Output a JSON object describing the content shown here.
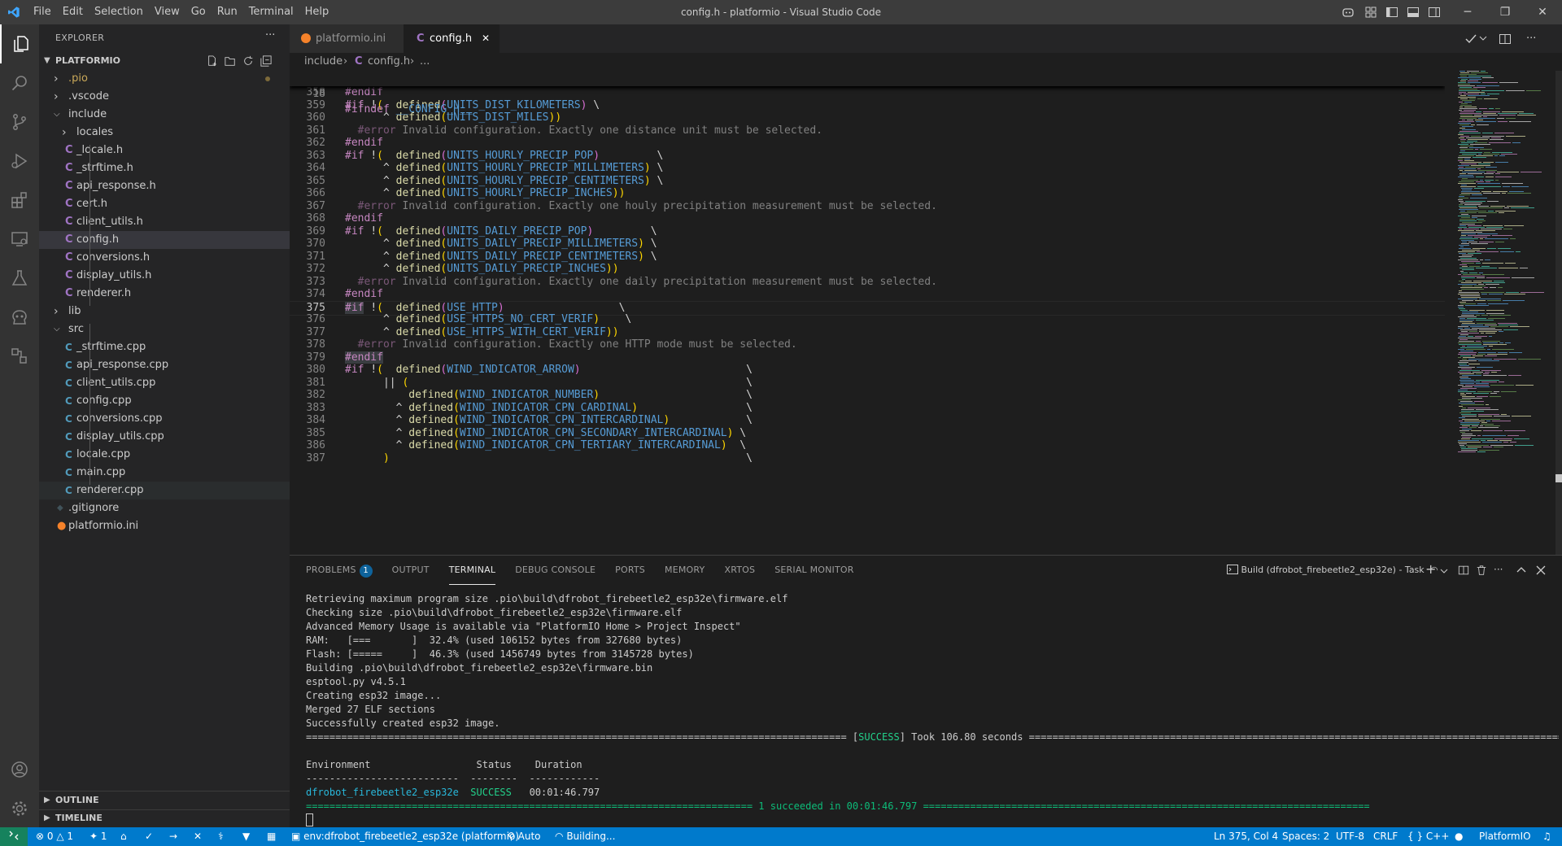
{
  "titlebar": {
    "menu": [
      "File",
      "Edit",
      "Selection",
      "View",
      "Go",
      "Run",
      "Terminal",
      "Help"
    ],
    "title": "config.h - platformio - Visual Studio Code",
    "window_controls": {
      "minimize": "─",
      "restore": "❐",
      "close": "✕"
    }
  },
  "activity_bar": {
    "items": [
      "files-icon",
      "search-icon",
      "source-control-icon",
      "run-debug-icon",
      "extensions-icon",
      "remote-explorer-icon",
      "testing-icon",
      "platformio-icon",
      "misc-icon"
    ],
    "bottom": [
      "account-icon",
      "settings-gear-icon"
    ]
  },
  "sidebar": {
    "title": "EXPLORER",
    "more": "···",
    "root": "PLATFORMIO",
    "tree": [
      {
        "label": ".pio",
        "kind": "folder",
        "depth": 0,
        "modified": true
      },
      {
        "label": ".vscode",
        "kind": "folder",
        "depth": 0
      },
      {
        "label": "include",
        "kind": "folder-open",
        "depth": 0
      },
      {
        "label": "locales",
        "kind": "folder",
        "depth": 1
      },
      {
        "label": "_locale.h",
        "kind": "h",
        "depth": 1
      },
      {
        "label": "_strftime.h",
        "kind": "h",
        "depth": 1
      },
      {
        "label": "api_response.h",
        "kind": "h",
        "depth": 1
      },
      {
        "label": "cert.h",
        "kind": "h",
        "depth": 1
      },
      {
        "label": "client_utils.h",
        "kind": "h",
        "depth": 1
      },
      {
        "label": "config.h",
        "kind": "h",
        "depth": 1,
        "selected": true
      },
      {
        "label": "conversions.h",
        "kind": "h",
        "depth": 1
      },
      {
        "label": "display_utils.h",
        "kind": "h",
        "depth": 1
      },
      {
        "label": "renderer.h",
        "kind": "h",
        "depth": 1
      },
      {
        "label": "lib",
        "kind": "folder",
        "depth": 0
      },
      {
        "label": "src",
        "kind": "folder-open",
        "depth": 0
      },
      {
        "label": "_strftime.cpp",
        "kind": "cpp",
        "depth": 1
      },
      {
        "label": "api_response.cpp",
        "kind": "cpp",
        "depth": 1
      },
      {
        "label": "client_utils.cpp",
        "kind": "cpp",
        "depth": 1
      },
      {
        "label": "config.cpp",
        "kind": "cpp",
        "depth": 1
      },
      {
        "label": "conversions.cpp",
        "kind": "cpp",
        "depth": 1
      },
      {
        "label": "display_utils.cpp",
        "kind": "cpp",
        "depth": 1
      },
      {
        "label": "locale.cpp",
        "kind": "cpp",
        "depth": 1
      },
      {
        "label": "main.cpp",
        "kind": "cpp",
        "depth": 1
      },
      {
        "label": "renderer.cpp",
        "kind": "cpp",
        "depth": 1,
        "hover": true
      },
      {
        "label": ".gitignore",
        "kind": "git",
        "depth": 0
      },
      {
        "label": "platformio.ini",
        "kind": "pio",
        "depth": 0
      }
    ],
    "outline": "OUTLINE",
    "timeline": "TIMELINE"
  },
  "tabs": [
    {
      "label": "platformio.ini",
      "active": false
    },
    {
      "label": "config.h",
      "active": true,
      "close": "✕"
    }
  ],
  "breadcrumb": {
    "folder": "include",
    "file": "config.h",
    "more": "..."
  },
  "editor": {
    "sticky": {
      "num": "18",
      "text": "#ifndef __CONFIG_H__"
    },
    "current_line": "375",
    "lines": [
      {
        "num": "358",
        "text": "#endif"
      },
      {
        "num": "359",
        "text": "#if !(  defined(UNITS_DIST_KILOMETERS) \\"
      },
      {
        "num": "360",
        "text": "      ^ defined(UNITS_DIST_MILES))"
      },
      {
        "num": "361",
        "text": "  #error Invalid configuration. Exactly one distance unit must be selected."
      },
      {
        "num": "362",
        "text": "#endif"
      },
      {
        "num": "363",
        "text": "#if !(  defined(UNITS_HOURLY_PRECIP_POP)         \\"
      },
      {
        "num": "364",
        "text": "      ^ defined(UNITS_HOURLY_PRECIP_MILLIMETERS) \\"
      },
      {
        "num": "365",
        "text": "      ^ defined(UNITS_HOURLY_PRECIP_CENTIMETERS) \\"
      },
      {
        "num": "366",
        "text": "      ^ defined(UNITS_HOURLY_PRECIP_INCHES))"
      },
      {
        "num": "367",
        "text": "  #error Invalid configuration. Exactly one houly precipitation measurement must be selected."
      },
      {
        "num": "368",
        "text": "#endif"
      },
      {
        "num": "369",
        "text": "#if !(  defined(UNITS_DAILY_PRECIP_POP)         \\"
      },
      {
        "num": "370",
        "text": "      ^ defined(UNITS_DAILY_PRECIP_MILLIMETERS) \\"
      },
      {
        "num": "371",
        "text": "      ^ defined(UNITS_DAILY_PRECIP_CENTIMETERS) \\"
      },
      {
        "num": "372",
        "text": "      ^ defined(UNITS_DAILY_PRECIP_INCHES))"
      },
      {
        "num": "373",
        "text": "  #error Invalid configuration. Exactly one daily precipitation measurement must be selected."
      },
      {
        "num": "374",
        "text": "#endif"
      },
      {
        "num": "375",
        "text": "#if !(  defined(USE_HTTP)                  \\"
      },
      {
        "num": "376",
        "text": "      ^ defined(USE_HTTPS_NO_CERT_VERIF)    \\"
      },
      {
        "num": "377",
        "text": "      ^ defined(USE_HTTPS_WITH_CERT_VERIF))"
      },
      {
        "num": "378",
        "text": "  #error Invalid configuration. Exactly one HTTP mode must be selected."
      },
      {
        "num": "379",
        "text": "#endif"
      },
      {
        "num": "380",
        "text": "#if !(  defined(WIND_INDICATOR_ARROW)                          \\"
      },
      {
        "num": "381",
        "text": "      || (                                                     \\"
      },
      {
        "num": "382",
        "text": "          defined(WIND_INDICATOR_NUMBER)                       \\"
      },
      {
        "num": "383",
        "text": "        ^ defined(WIND_INDICATOR_CPN_CARDINAL)                 \\"
      },
      {
        "num": "384",
        "text": "        ^ defined(WIND_INDICATOR_CPN_INTERCARDINAL)            \\"
      },
      {
        "num": "385",
        "text": "        ^ defined(WIND_INDICATOR_CPN_SECONDARY_INTERCARDINAL) \\"
      },
      {
        "num": "386",
        "text": "        ^ defined(WIND_INDICATOR_CPN_TERTIARY_INTERCARDINAL)  \\"
      },
      {
        "num": "387",
        "text": "      )                                                        \\"
      }
    ]
  },
  "panel": {
    "tabs": [
      {
        "label": "PROBLEMS",
        "badge": "1"
      },
      {
        "label": "OUTPUT"
      },
      {
        "label": "TERMINAL",
        "active": true
      },
      {
        "label": "DEBUG CONSOLE"
      },
      {
        "label": "PORTS"
      },
      {
        "label": "MEMORY"
      },
      {
        "label": "XRTOS"
      },
      {
        "label": "SERIAL MONITOR"
      }
    ],
    "task": "Build (dfrobot_firebeetle2_esp32e) - Task",
    "terminal": [
      "Retrieving maximum program size .pio\\build\\dfrobot_firebeetle2_esp32e\\firmware.elf",
      "Checking size .pio\\build\\dfrobot_firebeetle2_esp32e\\firmware.elf",
      "Advanced Memory Usage is available via \"PlatformIO Home > Project Inspect\"",
      "RAM:   [===       ]  32.4% (used 106152 bytes from 327680 bytes)",
      "Flash: [=====     ]  46.3% (used 1456749 bytes from 3145728 bytes)",
      "Building .pio\\build\\dfrobot_firebeetle2_esp32e\\firmware.bin",
      "esptool.py v4.5.1",
      "Creating esp32 image...",
      "Merged 27 ELF sections",
      "Successfully created esp32 image."
    ],
    "success_line": {
      "left": "============================================================================================",
      "tag": "SUCCESS",
      "rest": "Took 106.80 seconds",
      "right": "=============================================================================================="
    },
    "summary": {
      "headers": [
        "Environment",
        "Status",
        "Duration"
      ],
      "dashes": "--------------------------  --------  ------------",
      "env": "dfrobot_firebeetle2_esp32e",
      "status": "SUCCESS",
      "duration": "00:01:46.797"
    },
    "final_line": "============================================================================ 1 succeeded in 00:01:46.797 ============================================================================"
  },
  "statusbar": {
    "errors": "0",
    "warnings": "1",
    "ports": "1",
    "env": "env:dfrobot_firebeetle2_esp32e (platformio)",
    "auto": "Auto",
    "building": "Building...",
    "position": "Ln 375, Col 4",
    "spaces": "Spaces: 2",
    "encoding": "UTF-8",
    "eol": "CRLF",
    "language": "C++",
    "platform": "PlatformIO"
  }
}
